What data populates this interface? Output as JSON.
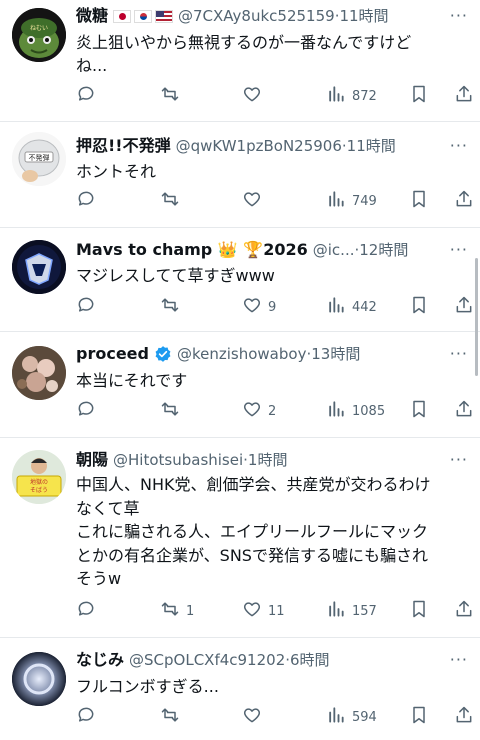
{
  "tweets": [
    {
      "name": "微糖",
      "handle": "@7CXAy8ukc525159",
      "time": "11時間",
      "text": "炎上狙いやから無視するのが一番なんですけど\nね...",
      "replies": "",
      "retweets": "",
      "likes": "",
      "views": "872"
    },
    {
      "name": "押忍!!不発弾",
      "handle": "@qwKW1pzBoN25906",
      "time": "11時間",
      "text": "ホントそれ",
      "replies": "",
      "retweets": "",
      "likes": "",
      "views": "749"
    },
    {
      "name": "Mavs to champ 👑 🏆2026",
      "handle": "@ic...",
      "time": "12時間",
      "text": "マジレスしてて草すぎwww",
      "replies": "",
      "retweets": "",
      "likes": "9",
      "views": "442"
    },
    {
      "name": "proceed",
      "handle": "@kenzishowaboy",
      "time": "13時間",
      "text": "本当にそれです",
      "replies": "",
      "retweets": "",
      "likes": "2",
      "views": "1085"
    },
    {
      "name": "朝陽",
      "handle": "@Hitotsubashisei",
      "time": "1時間",
      "text": "中国人、NHK党、創価学会、共産党が交わるわけ\nなくて草\nこれに騙される人、エイプリールフールにマック\nとかの有名企業が、SNSで発信する嘘にも騙され\nそうw",
      "replies": "",
      "retweets": "1",
      "likes": "11",
      "views": "157"
    },
    {
      "name": "なじみ",
      "handle": "@SCpOLCXf4c91202",
      "time": "6時間",
      "text": "フルコンボすぎる...",
      "replies": "",
      "retweets": "",
      "likes": "",
      "views": "594"
    }
  ],
  "separator": "·",
  "more_label": "···",
  "avatar1_text": "ねむい",
  "avatar2_text": "不発弾",
  "avatar5_text": "地獄の\nそばう",
  "colors": {
    "text": "#0f1419",
    "muted": "#536471",
    "verified": "#1d9bf0",
    "divider": "#e6e9ec"
  },
  "icons": [
    "reply-icon",
    "retweet-icon",
    "like-icon",
    "views-icon",
    "bookmark-icon",
    "share-icon",
    "more-icon",
    "verified-icon"
  ]
}
